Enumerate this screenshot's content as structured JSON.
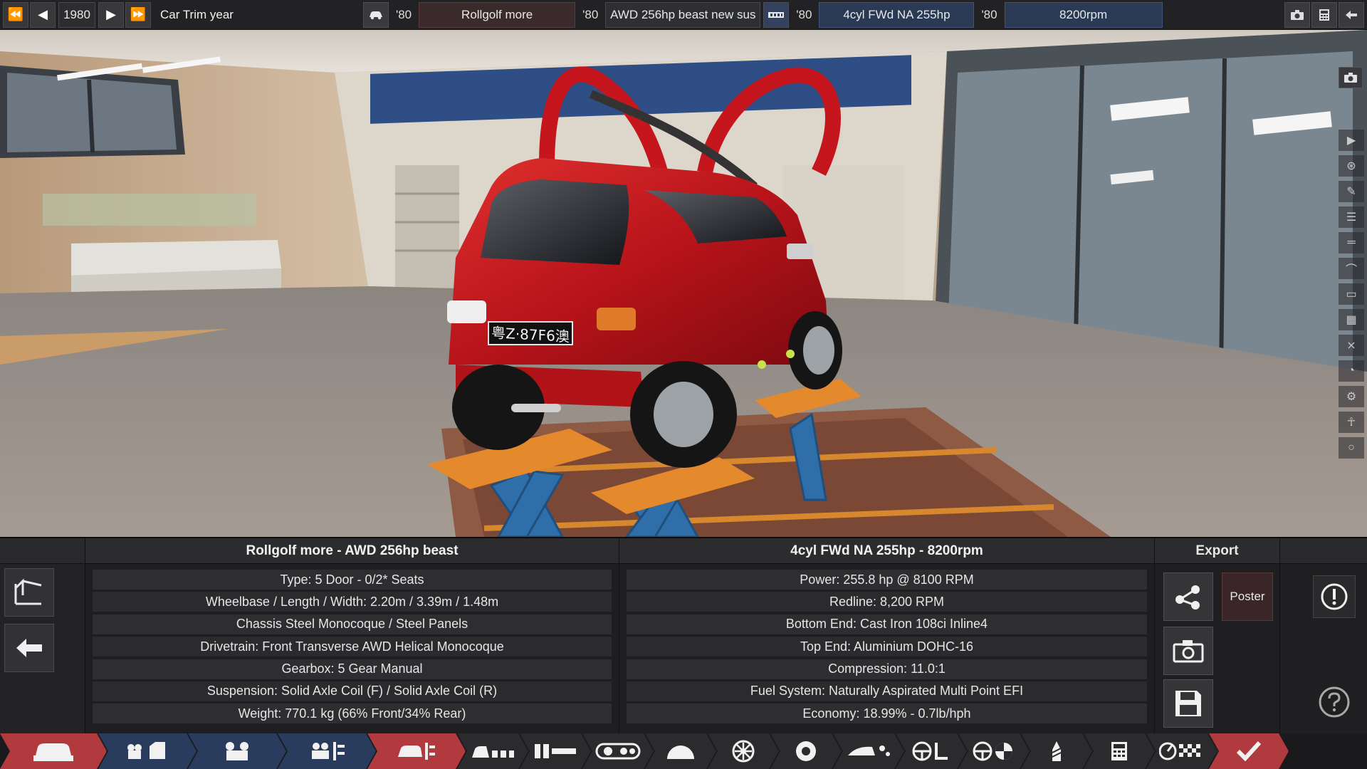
{
  "topbar": {
    "year": "1980",
    "trim_year_label": "Car Trim year",
    "model_year": "'80",
    "model_name": "Rollgolf more",
    "trim_year": "'80",
    "trim_name": "AWD 256hp beast  new sus",
    "family_year": "'80",
    "engine_family": "4cyl FWd NA 255hp",
    "variant_year": "'80",
    "engine_variant": "8200rpm"
  },
  "viewport": {
    "license_plate": "粤Z·87F6澳"
  },
  "panel": {
    "car_header": "Rollgolf more - AWD 256hp beast",
    "car_stats": [
      "Type: 5 Door - 0/2* Seats",
      "Wheelbase / Length / Width: 2.20m / 3.39m / 1.48m",
      "Chassis Steel Monocoque / Steel Panels",
      "Drivetrain: Front Transverse AWD Helical Monocoque",
      "Gearbox: 5 Gear Manual",
      "Suspension: Solid Axle Coil (F) / Solid Axle Coil (R)",
      "Weight: 770.1 kg (66% Front/34% Rear)"
    ],
    "engine_header": "4cyl FWd NA 255hp - 8200rpm",
    "engine_stats": [
      "Power: 255.8 hp @ 8100 RPM",
      "Redline:  8,200 RPM",
      "Bottom End: Cast Iron 108ci Inline4",
      "Top End: Aluminium DOHC-16",
      "Compression: 11.0:1",
      "Fuel System: Naturally Aspirated Multi Point EFI",
      "Economy: 18.99% - 0.7lb/hph"
    ],
    "export_header": "Export",
    "poster_label": "Poster"
  },
  "colors": {
    "accent_red": "#b13a3f",
    "accent_blue": "#2a3c5e",
    "car_red": "#c4161c",
    "lift_orange": "#e58a2c"
  }
}
